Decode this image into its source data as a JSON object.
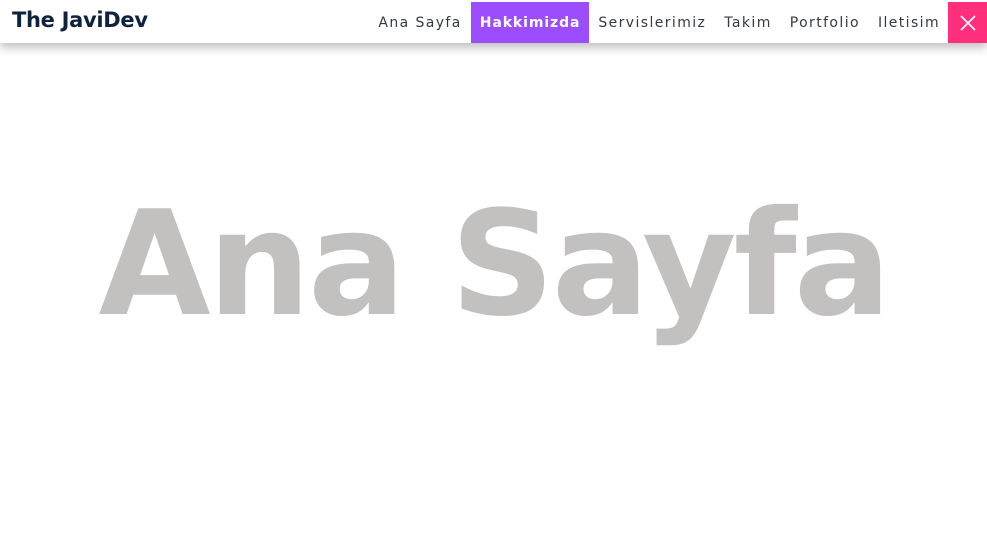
{
  "brand": {
    "name": "The JaviDev"
  },
  "nav": {
    "items": [
      {
        "label": "Ana Sayfa"
      },
      {
        "label": "Hakkimizda"
      },
      {
        "label": "Servislerimiz"
      },
      {
        "label": "Takim"
      },
      {
        "label": "Portfolio"
      },
      {
        "label": "Iletisim"
      }
    ],
    "active_index": 1
  },
  "close_button": {
    "icon": "close-icon"
  },
  "hero": {
    "title": "Ana Sayfa"
  },
  "colors": {
    "brand_text": "#10233d",
    "active_nav": "#9b4dff",
    "close_button": "#ff2f7c",
    "hero_text": "#c3c0c0"
  }
}
